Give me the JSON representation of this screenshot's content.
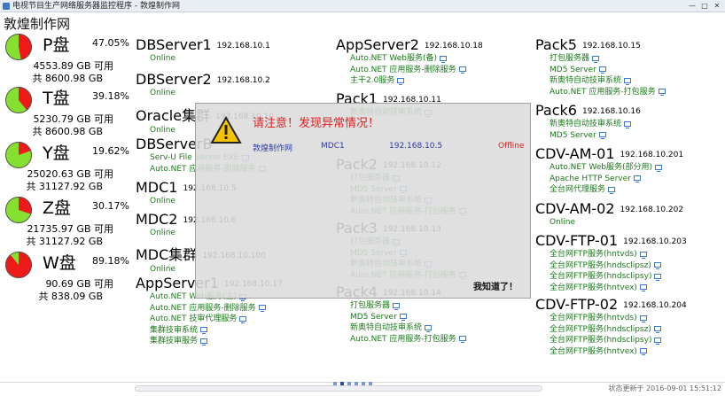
{
  "window": {
    "title": "电视节目生产网络服务器监控程序 - 敦煌制作网"
  },
  "brand": "敦煌制作网",
  "disks": [
    {
      "name": "P盘",
      "pct": "47.05%",
      "free": "4553.89 GB 可用",
      "total": "共 8600.98 GB",
      "used": 0.4705
    },
    {
      "name": "T盘",
      "pct": "39.18%",
      "free": "5230.79 GB 可用",
      "total": "共 8600.98 GB",
      "used": 0.3918
    },
    {
      "name": "Y盘",
      "pct": "19.62%",
      "free": "25020.63 GB 可用",
      "total": "共 31127.92 GB",
      "used": 0.1962
    },
    {
      "name": "Z盘",
      "pct": "30.17%",
      "free": "21735.97 GB 可用",
      "total": "共 31127.92 GB",
      "used": 0.3017
    },
    {
      "name": "W盘",
      "pct": "89.18%",
      "free": "90.69 GB 可用",
      "total": "共 838.09 GB",
      "used": 0.8918
    }
  ],
  "colors": {
    "used": "#ee1a1a",
    "free": "#86e030",
    "service": "#1a7a1a",
    "alert": "#e02020"
  },
  "col1": [
    {
      "name": "DBServer1",
      "ip": "192.168.10.1",
      "services": [
        "Online"
      ]
    },
    {
      "name": "DBServer2",
      "ip": "192.168.10.2",
      "services": [
        "Online"
      ]
    },
    {
      "name": "Oracle集群",
      "ip": "192.168.10.10",
      "services": [
        "Online"
      ]
    },
    {
      "name": "DBServerB",
      "ip": "",
      "services": [
        "Serv-U File Server EXE",
        "Auto.NET 应用服务-删除服务"
      ]
    },
    {
      "name": "MDC1",
      "ip": "192.168.10.5",
      "services": [
        "Online"
      ]
    },
    {
      "name": "MDC2",
      "ip": "192.168.10.6",
      "services": [
        "Online"
      ]
    },
    {
      "name": "MDC集群",
      "ip": "192.168.10.100",
      "services": [
        "Online"
      ]
    },
    {
      "name": "AppServer1",
      "ip": "192.168.10.17",
      "services": [
        "Auto.NET Web服务(主)",
        "Auto.NET 应用服务-删除服务",
        "Auto.NET 技审代理服务",
        "集群技审系统",
        "集群技审服务"
      ]
    }
  ],
  "col2": [
    {
      "name": "AppServer2",
      "ip": "192.168.10.18",
      "services": [
        "Auto.NET Web服务(备)",
        "Auto.NET 应用服务-删除服务",
        "主干2.0服务"
      ]
    },
    {
      "name": "Pack1",
      "ip": "192.168.10.11",
      "services": [
        "",
        "新奥特自动技审系统"
      ]
    },
    {
      "name": "Pack2",
      "ip": "192.168.10.12",
      "services": [
        "打包服务器",
        "MD5 Server",
        "新奥特自动技审系统",
        "Auto.NET 应用服务-打包服务"
      ]
    },
    {
      "name": "Pack3",
      "ip": "192.168.10.13",
      "services": [
        "打包服务器",
        "MD5 Server",
        "新奥特自动技审系统",
        "Auto.NET 应用服务-打包服务"
      ]
    },
    {
      "name": "Pack4",
      "ip": "192.168.10.14",
      "services": [
        "打包服务器",
        "MD5 Server",
        "新奥特自动技审系统",
        "Auto.NET 应用服务-打包服务"
      ]
    }
  ],
  "col3": [
    {
      "name": "Pack5",
      "ip": "192.168.10.15",
      "services": [
        "打包服务器",
        "MD5 Server",
        "新奥特自动技审系统",
        "Auto.NET 应用服务-打包服务"
      ]
    },
    {
      "name": "Pack6",
      "ip": "192.168.10.16",
      "services": [
        "新奥特自动技审系统",
        "MD5 Server"
      ]
    },
    {
      "name": "CDV-AM-01",
      "ip": "192.168.10.201",
      "services": [
        "Auto.NET Web服务(部分用)",
        "Apache HTTP Server",
        "全台网代理服务"
      ]
    },
    {
      "name": "CDV-AM-02",
      "ip": "192.168.10.202",
      "services": [
        "Online"
      ]
    },
    {
      "name": "CDV-FTP-01",
      "ip": "192.168.10.203",
      "services": [
        "全台网FTP服务(hntvds)",
        "全台网FTP服务(hndsclipsz)",
        "全台网FTP服务(hndsclipsy)",
        "全台网FTP服务(hntvex)"
      ]
    },
    {
      "name": "CDV-FTP-02",
      "ip": "192.168.10.204",
      "services": [
        "全台网FTP服务(hntvds)",
        "全台网FTP服务(hndsclipsz)",
        "全台网FTP服务(hndsclipsy)",
        "全台网FTP服务(hntvex)"
      ]
    }
  ],
  "alert": {
    "message": "请注意！发现异常情况！",
    "site": "敦煌制作网",
    "server": "MDC1",
    "ip": "192.168.10.5",
    "state": "Offline",
    "ok": "我知道了！"
  },
  "status": "状态更新于 2016-09-01 15:51:12"
}
